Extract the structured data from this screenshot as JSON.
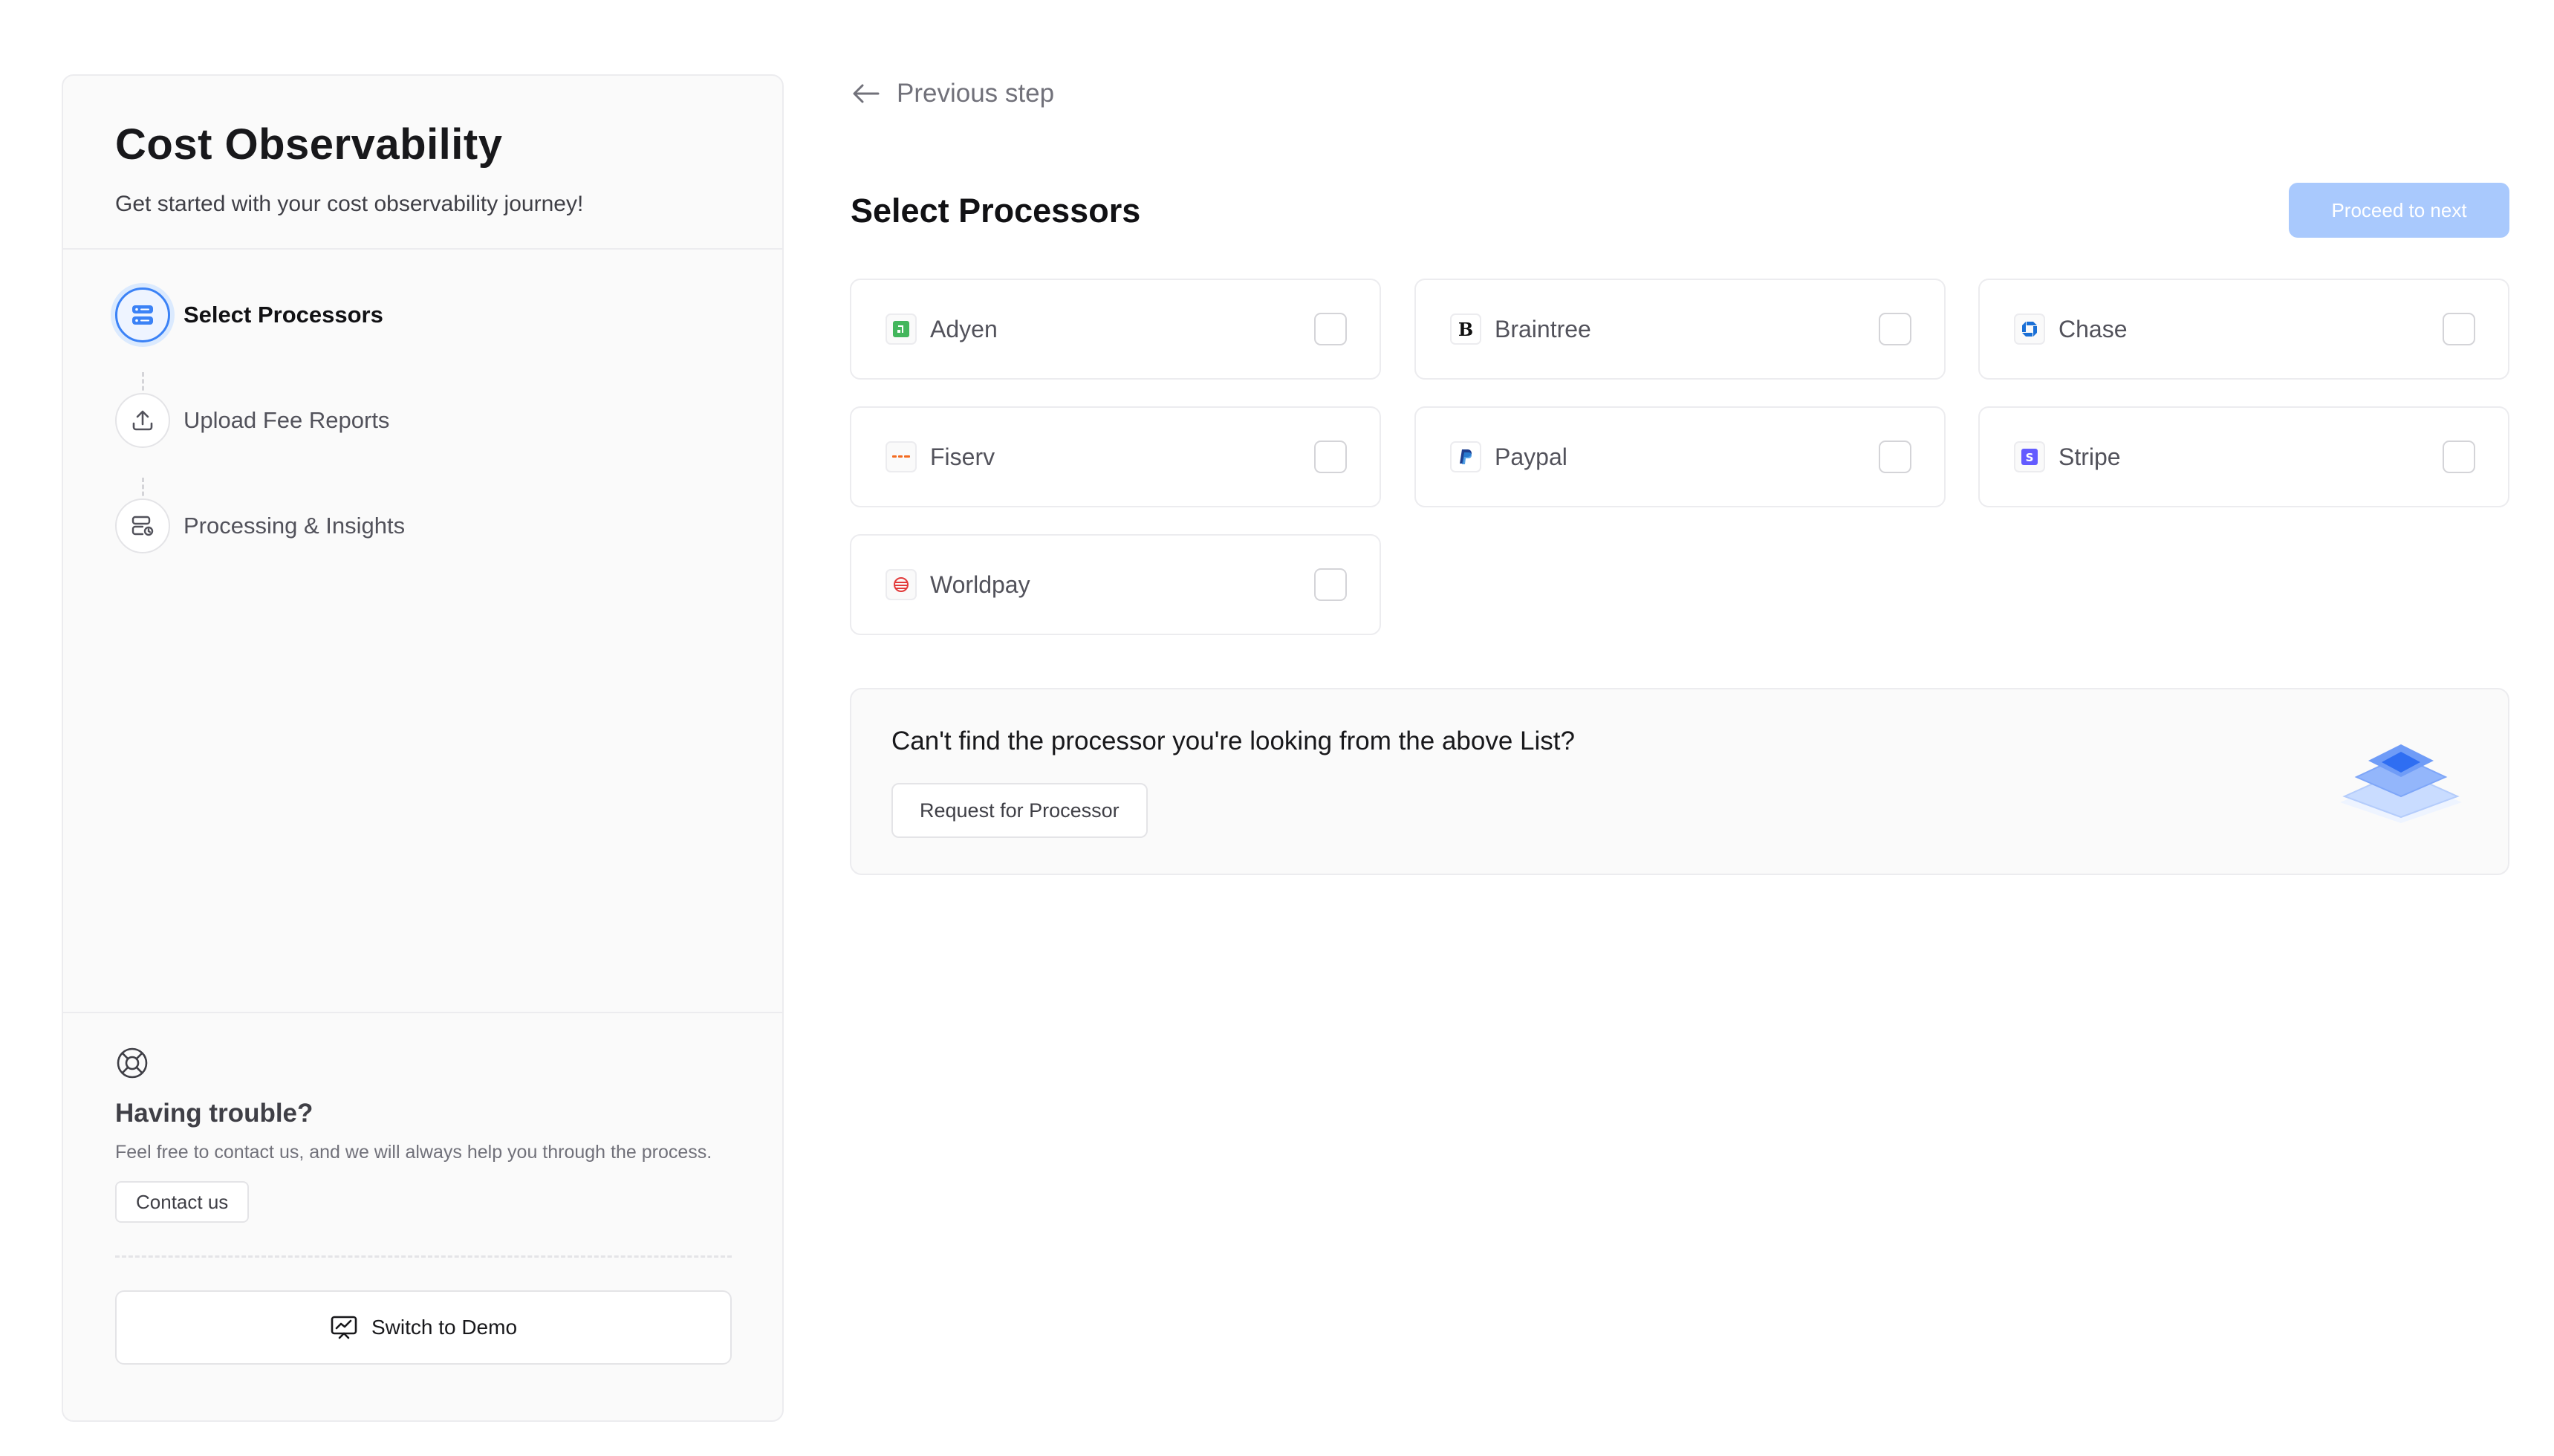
{
  "sidebar": {
    "title": "Cost Observability",
    "subtitle": "Get started with your cost observability journey!",
    "steps": [
      {
        "label": "Select Processors",
        "icon": "server-stack-icon",
        "active": true
      },
      {
        "label": "Upload Fee Reports",
        "icon": "upload-icon",
        "active": false
      },
      {
        "label": "Processing & Insights",
        "icon": "processing-icon",
        "active": false
      }
    ],
    "help": {
      "icon": "lifebuoy-icon",
      "title": "Having trouble?",
      "text": "Feel free to contact us, and we will always help you through the process.",
      "contact_label": "Contact us"
    },
    "demo_label": "Switch to Demo"
  },
  "main": {
    "previous_step_label": "Previous step",
    "title": "Select Processors",
    "proceed_label": "Proceed to next",
    "processors": [
      {
        "name": "Adyen",
        "logo": "adyen-logo-icon",
        "color": "#43b65c",
        "checked": false
      },
      {
        "name": "Braintree",
        "logo": "braintree-logo-icon",
        "color": "#111111",
        "checked": false
      },
      {
        "name": "Chase",
        "logo": "chase-logo-icon",
        "color": "#1a6fd6",
        "checked": false
      },
      {
        "name": "Fiserv",
        "logo": "fiserv-logo-icon",
        "color": "#f36c21",
        "checked": false
      },
      {
        "name": "Paypal",
        "logo": "paypal-logo-icon",
        "color": "#1f3f8f",
        "checked": false
      },
      {
        "name": "Stripe",
        "logo": "stripe-logo-icon",
        "color": "#635bff",
        "checked": false
      },
      {
        "name": "Worldpay",
        "logo": "worldpay-logo-icon",
        "color": "#e23b3b",
        "checked": false
      }
    ],
    "request": {
      "question": "Can't find the processor you're looking from the above List?",
      "button_label": "Request for Processor",
      "illustration": "layers-icon"
    }
  },
  "colors": {
    "accent": "#3b82f6",
    "proceed_disabled": "#a9c9fd",
    "border": "#ececef"
  }
}
